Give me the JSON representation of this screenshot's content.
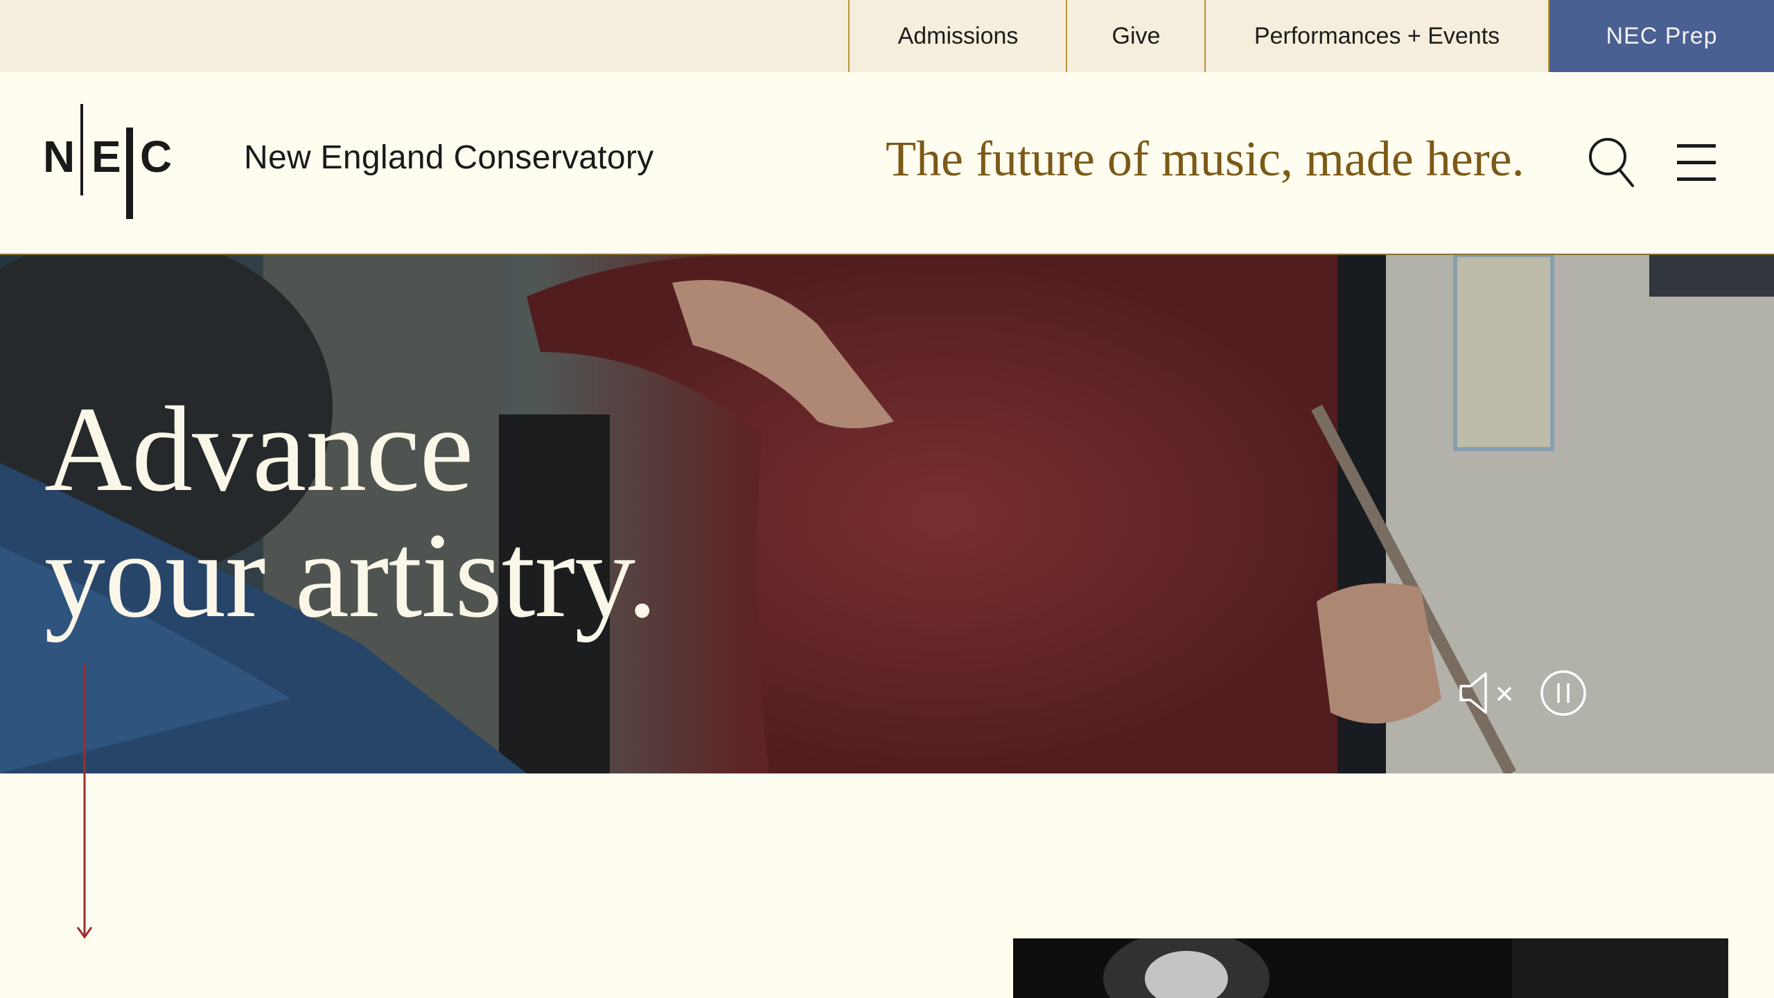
{
  "utility_nav": {
    "admissions": "Admissions",
    "give": "Give",
    "performances": "Performances + Events",
    "prep": "NEC Prep"
  },
  "header": {
    "logo_letters": [
      "N",
      "E",
      "C"
    ],
    "site_name": "New England Conservatory",
    "tagline": "The future of music, made here."
  },
  "hero": {
    "title_line1": "Advance",
    "title_line2": "your artistry."
  },
  "icons": {
    "search": "search-icon",
    "menu": "hamburger-menu-icon",
    "mute": "speaker-muted-icon",
    "pause": "pause-icon",
    "scroll": "arrow-down-icon"
  },
  "colors": {
    "utility_bg": "#f6eedc",
    "page_bg": "#fefdf0",
    "prep_bg": "#4a5f92",
    "tagline": "#7b5a17",
    "accent_red": "#9b2d2d",
    "divider_gold": "#b8933c"
  }
}
